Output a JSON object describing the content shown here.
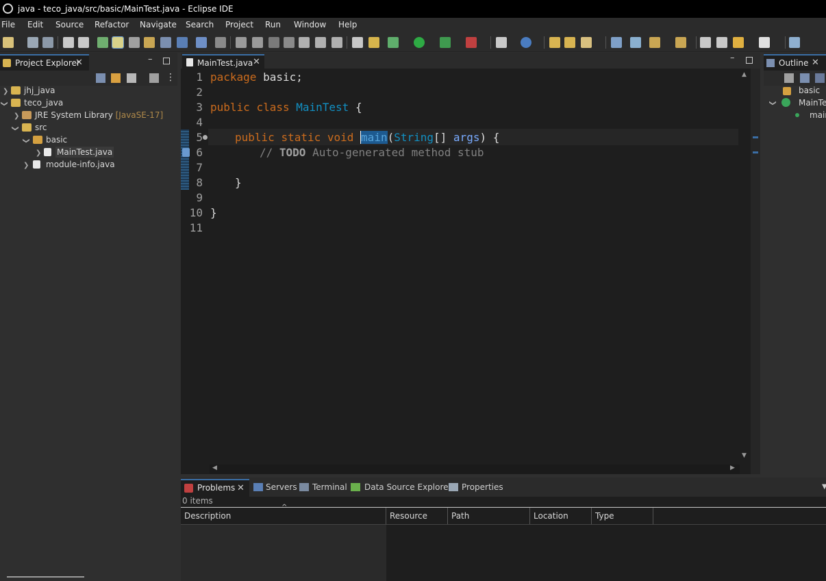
{
  "window": {
    "title": "java - teco_java/src/basic/MainTest.java - Eclipse IDE"
  },
  "menu": [
    "File",
    "Edit",
    "Source",
    "Refactor",
    "Navigate",
    "Search",
    "Project",
    "Run",
    "Window",
    "Help"
  ],
  "project_explorer": {
    "title": "Project Explorer",
    "tree": [
      {
        "label": "jhj_java"
      },
      {
        "label": "teco_java"
      },
      {
        "label": "JRE System Library",
        "suffix": "[JavaSE-17]"
      },
      {
        "label": "src"
      },
      {
        "label": "basic"
      },
      {
        "label": "MainTest.java"
      },
      {
        "label": "module-info.java"
      }
    ]
  },
  "editor": {
    "tab_label": "MainTest.java",
    "line_numbers": [
      "1",
      "2",
      "3",
      "4",
      "5",
      "6",
      "7",
      "8",
      "9",
      "10",
      "11"
    ],
    "code": {
      "l1_kw": "package",
      "l1_rest": " basic;",
      "l3_kw1": "public",
      "l3_kw2": "class",
      "l3_cls": "MainTest",
      "l3_rest": " {",
      "l5_kw1": "public",
      "l5_kw2": "static",
      "l5_kw3": "void",
      "l5_method": "main",
      "l5_p1": "(",
      "l5_type": "String",
      "l5_p2": "[] ",
      "l5_arg": "args",
      "l5_p3": ") {",
      "l6_cmt1": "// ",
      "l6_todo": "TODO",
      "l6_cmt2": " Auto-generated method stub",
      "l8": "}",
      "l10": "}"
    }
  },
  "outline": {
    "title": "Outline",
    "items": [
      {
        "label": "basic"
      },
      {
        "label": "MainTe"
      },
      {
        "label": "main"
      }
    ]
  },
  "bottom_panel": {
    "tabs": [
      "Problems",
      "Servers",
      "Terminal",
      "Data Source Explorer",
      "Properties"
    ],
    "status": "0 items",
    "columns": [
      "Description",
      "Resource",
      "Path",
      "Location",
      "Type"
    ]
  },
  "colors": {
    "keyword": "#cc6c1d",
    "class": "#1290c3",
    "variable": "#79abff",
    "accent": "#3b6ea5"
  }
}
